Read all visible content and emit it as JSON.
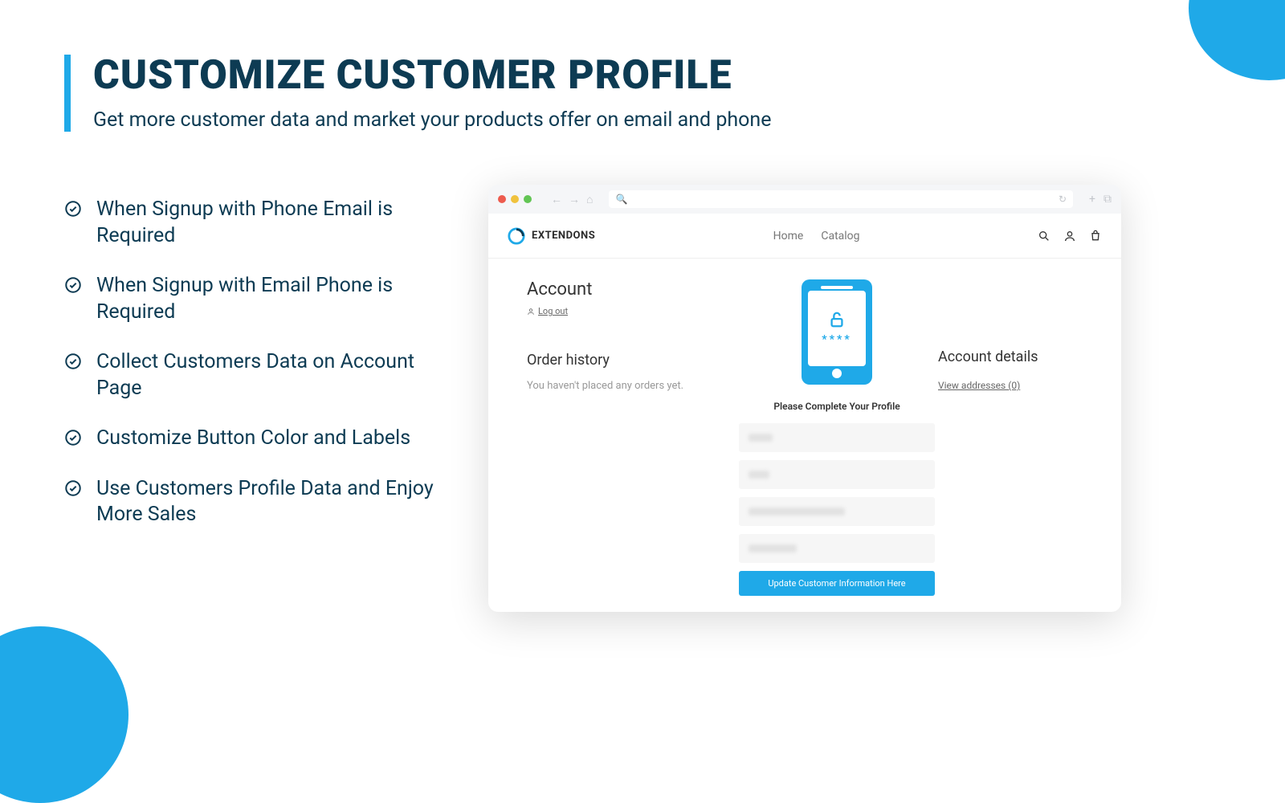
{
  "header": {
    "title": "CUSTOMIZE CUSTOMER PROFILE",
    "subtitle": "Get more customer data and market your products offer on email and phone"
  },
  "bullets": [
    "When Signup with Phone Email is Required",
    "When Signup with Email Phone is Required",
    "Collect Customers Data on Account Page",
    "Customize Button Color and Labels",
    "Use Customers Profile Data and Enjoy More Sales"
  ],
  "browser": {
    "brand": "EXTENDONS",
    "nav": {
      "home": "Home",
      "catalog": "Catalog"
    }
  },
  "account": {
    "title": "Account",
    "logout": "Log out",
    "order_history_title": "Order history",
    "order_history_empty": "You haven't placed any orders yet.",
    "details_title": "Account details",
    "view_addresses": "View addresses (0)",
    "prompt": "Please Complete Your Profile",
    "button": "Update Customer Information Here",
    "stars": "****"
  }
}
